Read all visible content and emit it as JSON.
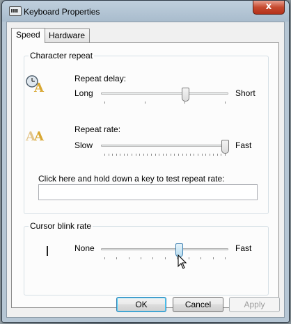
{
  "window": {
    "title": "Keyboard Properties",
    "close_glyph": "x"
  },
  "tabs": [
    {
      "label": "Speed",
      "selected": true
    },
    {
      "label": "Hardware",
      "selected": false
    }
  ],
  "character_repeat": {
    "group_label": "Character repeat",
    "repeat_delay": {
      "label": "Repeat delay:",
      "min_label": "Long",
      "max_label": "Short",
      "icon": "clock-letter-a-icon",
      "position_fraction": 0.67,
      "tick_count": 4
    },
    "repeat_rate": {
      "label": "Repeat rate:",
      "min_label": "Slow",
      "max_label": "Fast",
      "icon": "double-letter-a-icon",
      "position_fraction": 1.0,
      "tick_count": 32
    },
    "test_prompt": "Click here and hold down a key to test repeat rate:",
    "test_value": ""
  },
  "cursor_blink": {
    "group_label": "Cursor blink rate",
    "min_label": "None",
    "max_label": "Fast",
    "position_fraction": 0.62,
    "tick_count": 11,
    "icon": "text-cursor-icon"
  },
  "buttons": {
    "ok": "OK",
    "cancel": "Cancel",
    "apply": "Apply"
  },
  "colors": {
    "title_bar": "#a9bccd",
    "close_button": "#c64a2f",
    "panel": "#fcfcfc",
    "default_button_glow": "#48d0f9"
  }
}
